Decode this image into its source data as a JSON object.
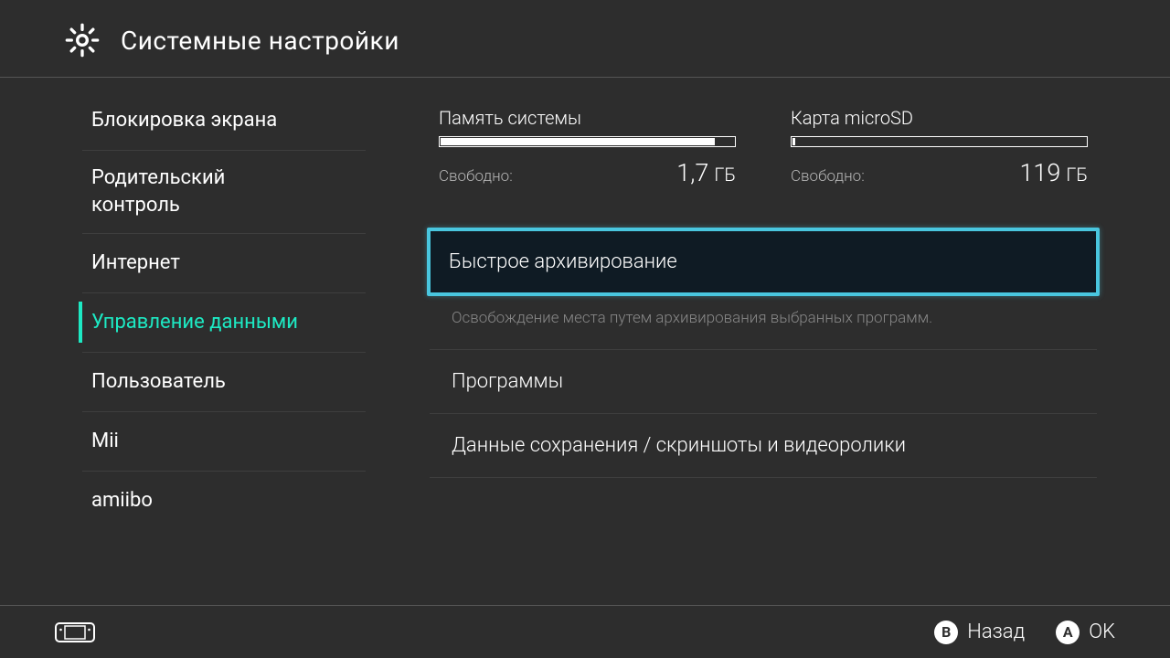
{
  "header": {
    "title": "Системные настройки"
  },
  "sidebar": {
    "items": [
      {
        "label": "Блокировка экрана"
      },
      {
        "label_line1": "Родительский",
        "label_line2": "контроль"
      },
      {
        "label": "Интернет"
      },
      {
        "label": "Управление данными"
      },
      {
        "label": "Пользователь"
      },
      {
        "label": "Mii"
      },
      {
        "label": "amiibo"
      }
    ]
  },
  "storage": {
    "free_label": "Свободно:",
    "system": {
      "title": "Память системы",
      "free_value": "1,7",
      "free_unit": "ГБ",
      "used_percent": 93
    },
    "sd": {
      "title": "Карта microSD",
      "free_value": "119",
      "free_unit": "ГБ",
      "used_percent": 1
    }
  },
  "options": {
    "quick_archive": "Быстрое архивирование",
    "quick_archive_desc": "Освобождение места путем архивирования выбранных программ.",
    "software": "Программы",
    "save_data": "Данные сохранения / скриншоты и видеоролики"
  },
  "footer": {
    "back_key": "B",
    "back_label": "Назад",
    "ok_key": "A",
    "ok_label": "OK"
  }
}
